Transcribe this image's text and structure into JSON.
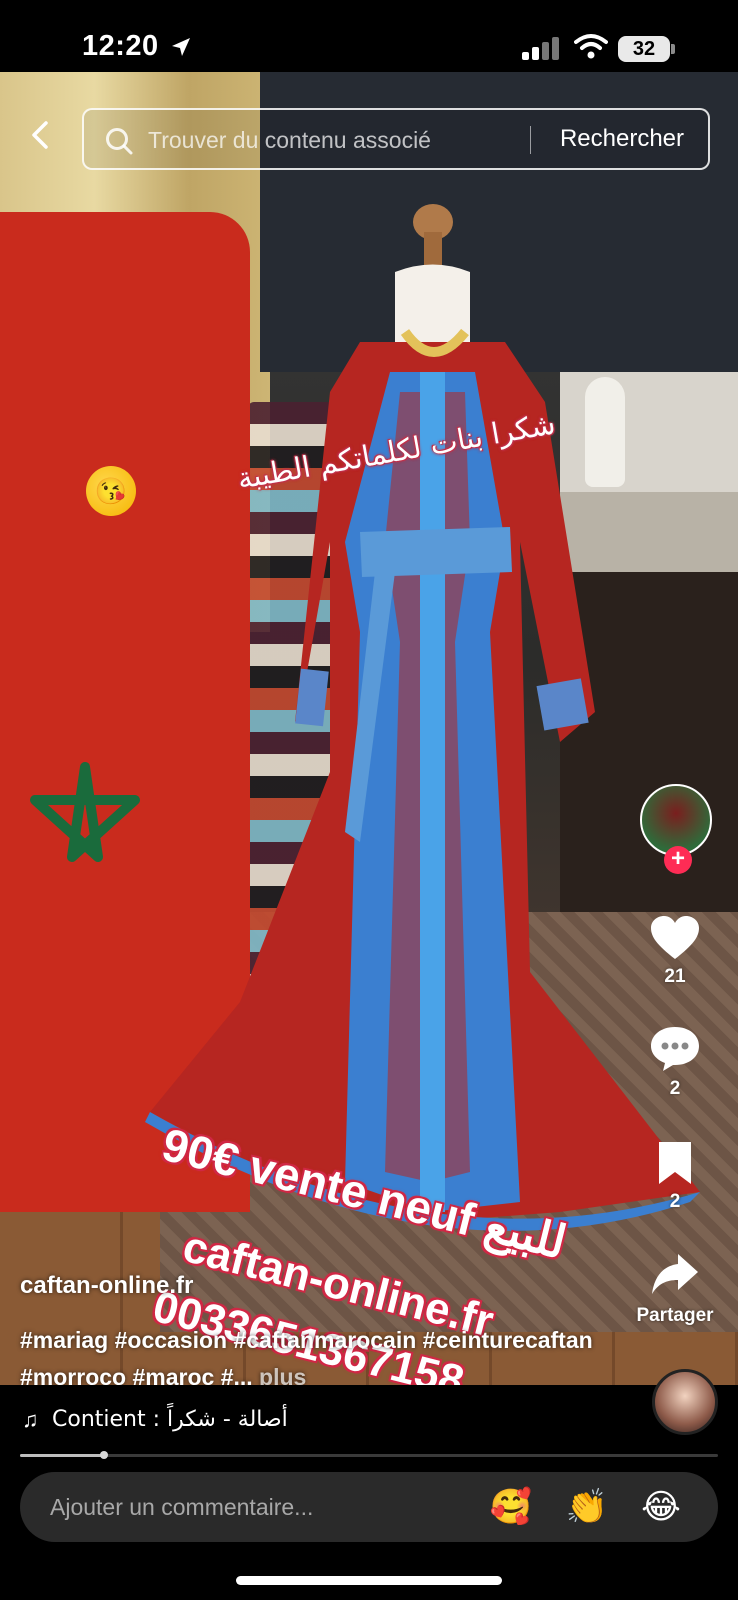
{
  "status_bar": {
    "time": "12:20",
    "battery": "32"
  },
  "search": {
    "placeholder": "Trouver du contenu associé",
    "button_label": "Rechercher"
  },
  "video_overlay": {
    "arabic_caption": "شكرا بنات لكلماتكم الطيبة",
    "emoji": "😘",
    "price_sticker": "90€ vente neuf للبيع",
    "site_sticker": "caftan-online.fr",
    "phone_sticker": "0033651367158"
  },
  "rail": {
    "likes": "21",
    "comments": "2",
    "bookmarks": "2",
    "share_label": "Partager"
  },
  "caption": {
    "username": "caftan-online.fr",
    "hashtags": "#mariag #occasion #caftanmarocain #ceinturecaftan #morroco #maroc #...",
    "more_label": "plus"
  },
  "sound": {
    "text": "Contient : أصالة - شكراً"
  },
  "playback": {
    "progress": 0.12
  },
  "comment_box": {
    "placeholder": "Ajouter un commentaire...",
    "quick_emojis": [
      "🥰",
      "👏",
      "😂"
    ]
  },
  "colors": {
    "accent": "#fe2c55",
    "sticker_outline": "#d02845",
    "flag_red": "#c92b1d",
    "flag_green": "#1a6b3c"
  }
}
